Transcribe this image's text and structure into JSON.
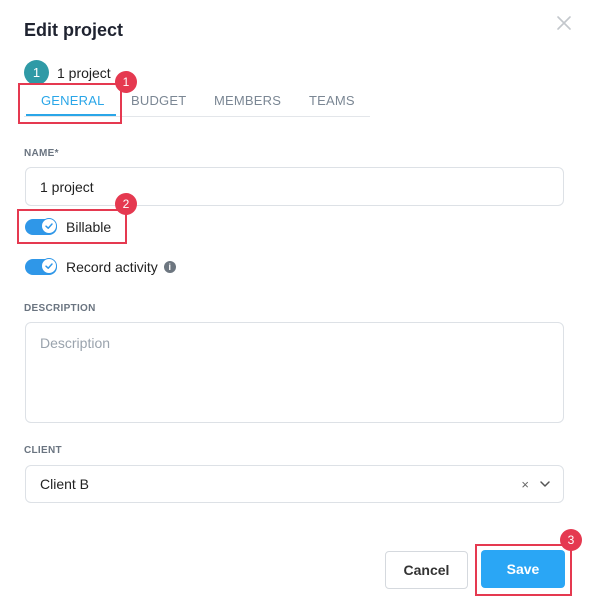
{
  "dialog": {
    "title": "Edit project"
  },
  "step": {
    "number": "1",
    "project_name": "1 project"
  },
  "tabs": [
    {
      "label": "GENERAL",
      "active": true
    },
    {
      "label": "BUDGET",
      "active": false
    },
    {
      "label": "MEMBERS",
      "active": false
    },
    {
      "label": "TEAMS",
      "active": false
    }
  ],
  "form": {
    "name": {
      "label": "NAME*",
      "value": "1 project"
    },
    "billable": {
      "label": "Billable",
      "enabled": true
    },
    "record_activity": {
      "label": "Record activity",
      "enabled": true
    },
    "description": {
      "label": "DESCRIPTION",
      "placeholder": "Description",
      "value": ""
    },
    "client": {
      "label": "CLIENT",
      "value": "Client B"
    }
  },
  "actions": {
    "cancel_label": "Cancel",
    "save_label": "Save"
  },
  "annotations": [
    {
      "number": "1"
    },
    {
      "number": "2"
    },
    {
      "number": "3"
    }
  ],
  "colors": {
    "accent": "#2aa6f5",
    "highlight": "#e53950",
    "step": "#2f9aa6"
  }
}
